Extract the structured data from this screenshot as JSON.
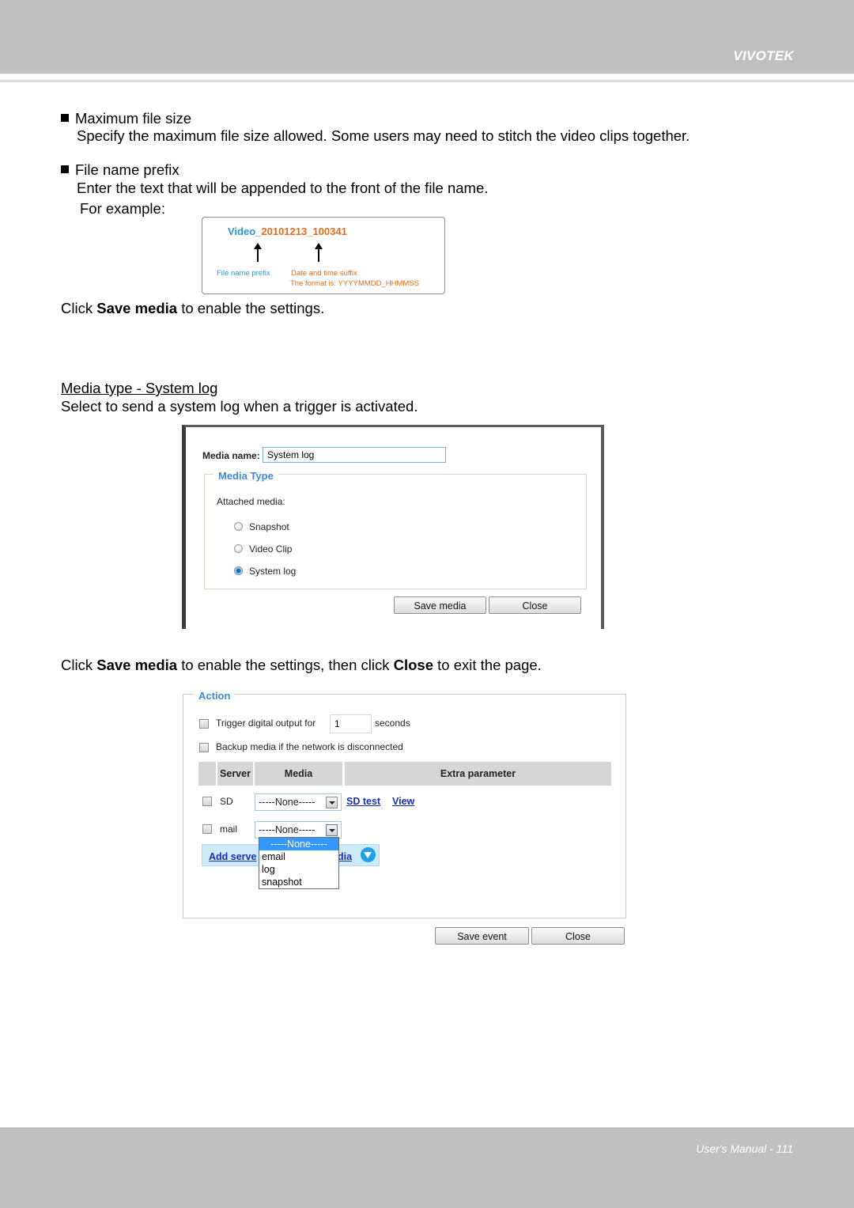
{
  "header": {
    "brand": "VIVOTEK"
  },
  "footer": {
    "page_label": "User's Manual - 111"
  },
  "sections": {
    "max_file_size": {
      "title": "Maximum file size",
      "body": "Specify the maximum file size allowed. Some users may need to stitch the video clips together."
    },
    "file_name_prefix": {
      "title": "File name prefix",
      "body": "Enter the text that will be appended to the front of the file name.",
      "example_label": "For example:",
      "example": {
        "prefix": "Video_",
        "suffix": "20101213_100341",
        "prefix_label": "File name prefix",
        "suffix_label": "Date and time suffix",
        "format_label": "The format is: YYYYMMDD_HHMMSS",
        "colors": {
          "prefix": "#2a98d8",
          "suffix": "#e36c1d"
        }
      }
    },
    "save_note": {
      "pre": "Click ",
      "bold": "Save media",
      "post": " to enable the settings."
    },
    "system_log": {
      "heading": "Media type - System log",
      "body": "Select to send a system log when a trigger is activated."
    },
    "save_close_note": {
      "pre": "Click ",
      "bold1": "Save media",
      "mid": " to enable the settings, then click ",
      "bold2": "Close",
      "post": " to exit the page."
    }
  },
  "media_dialog": {
    "media_name_label": "Media name:",
    "media_name_value": "System log",
    "media_type_legend": "Media Type",
    "attached_media_label": "Attached media:",
    "options": [
      {
        "label": "Snapshot",
        "checked": false
      },
      {
        "label": "Video Clip",
        "checked": false
      },
      {
        "label": "System log",
        "checked": true
      }
    ],
    "save_button": "Save media",
    "close_button": "Close"
  },
  "action_dialog": {
    "legend": "Action",
    "trigger_label": "Trigger digital output for",
    "trigger_value": "1",
    "trigger_unit": "seconds",
    "backup_label": "Backup media if the network is disconnected",
    "table_headers": [
      "",
      "Server",
      "Media",
      "Extra parameter"
    ],
    "rows": [
      {
        "server": "SD",
        "media": "-----None-----",
        "links": [
          "SD test",
          "View"
        ]
      },
      {
        "server": "mail",
        "media": "-----None-----",
        "links": []
      }
    ],
    "dropdown_options": [
      "-----None-----",
      "email",
      "log",
      "snapshot"
    ],
    "dropdown_selected": "-----None-----",
    "add_server_label": "Add serve",
    "add_media_label": "dia",
    "save_button": "Save event",
    "close_button": "Close"
  }
}
